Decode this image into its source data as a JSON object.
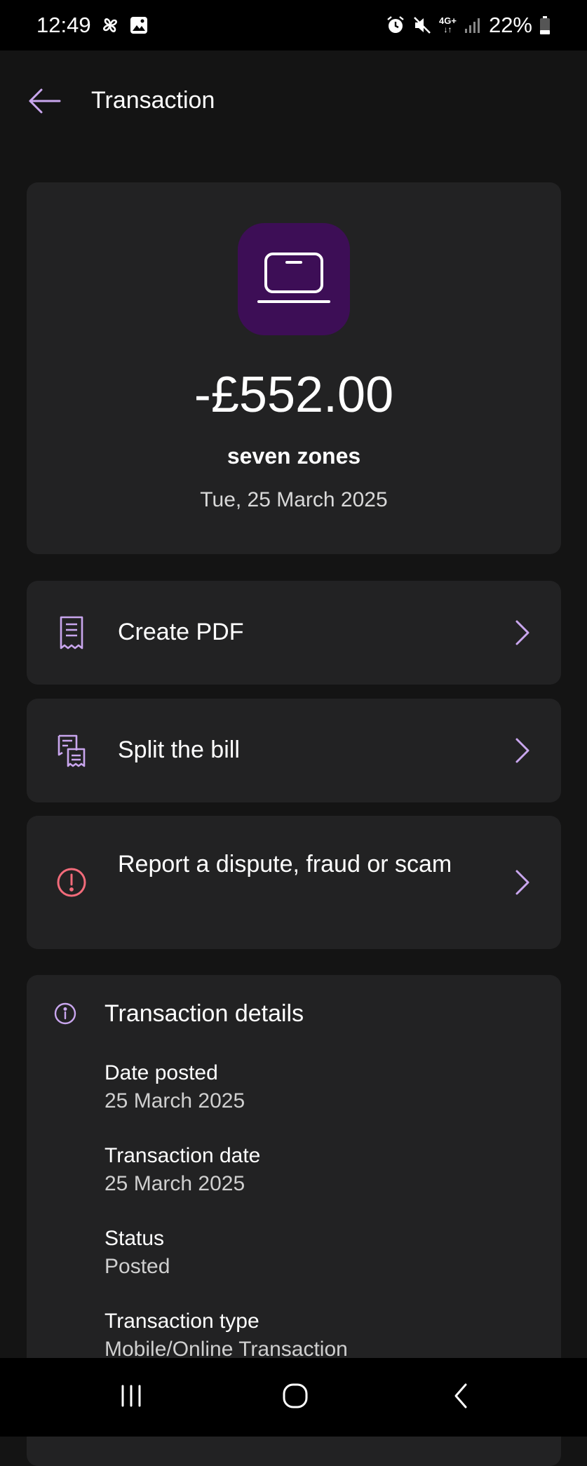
{
  "status_bar": {
    "time": "12:49",
    "network": "4G+",
    "battery": "22%",
    "icons": [
      "pinwheel-icon",
      "gallery-icon",
      "alarm-icon",
      "mute-icon",
      "network-icon",
      "signal-icon",
      "battery-icon"
    ]
  },
  "header": {
    "title": "Transaction",
    "back_icon": "arrow-left-icon"
  },
  "summary": {
    "merchant_icon": "laptop-icon",
    "amount": "-£552.00",
    "merchant": "seven zones",
    "date": "Tue, 25 March 2025"
  },
  "actions": [
    {
      "label": "Create PDF",
      "icon": "receipt-icon",
      "icon_color": "#c9a6ee"
    },
    {
      "label": "Split the bill",
      "icon": "split-receipt-icon",
      "icon_color": "#c9a6ee"
    },
    {
      "label": "Report a dispute, fraud or scam",
      "icon": "alert-circle-icon",
      "icon_color": "#f26b7a"
    }
  ],
  "details": {
    "title": "Transaction details",
    "icon": "info-icon",
    "items": [
      {
        "label": "Date posted",
        "value": "25 March 2025"
      },
      {
        "label": "Transaction date",
        "value": "25 March 2025"
      },
      {
        "label": "Status",
        "value": "Posted"
      },
      {
        "label": "Transaction type",
        "value": "Mobile/Online Transaction"
      }
    ]
  },
  "nav_bar": {
    "icons": [
      "recent-apps-icon",
      "home-icon",
      "back-icon"
    ]
  },
  "colors": {
    "background": "#141414",
    "card": "#222223",
    "accent": "#c9a6ee",
    "merchant_tile": "#3d0e56",
    "alert": "#f26b7a"
  }
}
